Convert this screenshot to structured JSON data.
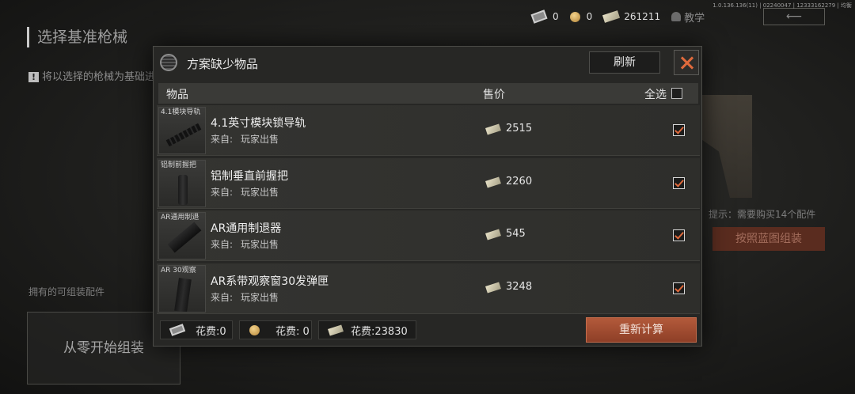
{
  "version": "1.0.136.136(11) | 02240047 | 12333162279 | 均衡",
  "hud": {
    "ticket": "0",
    "coin": "0",
    "cash": "261211",
    "teach_label": "教学"
  },
  "background": {
    "title": "选择基准枪械",
    "note": "将以选择的枪械为基础进",
    "owned_label": "拥有的可组装配件",
    "scratch_label": "从零开始组装",
    "hint": "提示：需要购买14个配件",
    "assemble_label": "按照蓝图组装"
  },
  "modal": {
    "title": "方案缺少物品",
    "refresh_label": "刷新",
    "header": {
      "item": "物品",
      "price": "售价",
      "select_all": "全选"
    },
    "items": [
      {
        "thumb_label": "4.1模块导轨",
        "name": "4.1英寸模块锁导轨",
        "from_label": "来自:",
        "source": "玩家出售",
        "price": "2515",
        "checked": true
      },
      {
        "thumb_label": "铝制前握把",
        "name": "铝制垂直前握把",
        "from_label": "来自:",
        "source": "玩家出售",
        "price": "2260",
        "checked": true
      },
      {
        "thumb_label": "AR通用制退",
        "name": "AR通用制退器",
        "from_label": "来自:",
        "source": "玩家出售",
        "price": "545",
        "checked": true
      },
      {
        "thumb_label": "AR 30观察",
        "name": "AR系带观察窗30发弹匣",
        "from_label": "来自:",
        "source": "玩家出售",
        "price": "3248",
        "checked": true
      }
    ],
    "footer": {
      "fee_ticket": "花费:0",
      "fee_coin": "花费: 0",
      "fee_cash": "花费:23830",
      "recalc_label": "重新计算"
    }
  },
  "colors": {
    "accent": "#e06a3c",
    "button": "#a04a2f",
    "panel": "#272725"
  }
}
